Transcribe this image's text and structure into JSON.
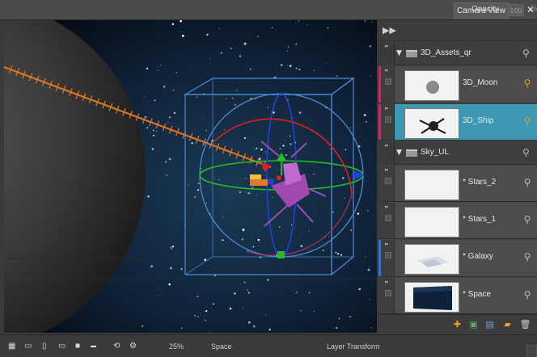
{
  "header": {
    "tab_label": "Camera View",
    "add_icon": "plus-icon",
    "close_icon": "close-icon"
  },
  "layers_panel": {
    "opacity_label": "Opacity",
    "opacity_value": "100",
    "opacity_suffix": "%",
    "groups": [
      {
        "name": "3D_Assets_qr",
        "layers": [
          {
            "name": "3D_Moon",
            "thumb": "moon",
            "strip_color": "#b8336a",
            "selected": false,
            "pin_icon": "gold-pin-icon"
          },
          {
            "name": "3D_Ship",
            "thumb": "ship",
            "strip_color": "#b8336a",
            "selected": true,
            "pin_icon": "gold-pin-icon"
          }
        ]
      },
      {
        "name": "Sky_UL",
        "layers": [
          {
            "name": "* Stars_2",
            "thumb": "blank",
            "strip_color": "",
            "selected": false,
            "pin_icon": "pin-icon"
          },
          {
            "name": "* Stars_1",
            "thumb": "blank",
            "strip_color": "",
            "selected": false,
            "pin_icon": "pin-icon"
          },
          {
            "name": "* Galaxy",
            "thumb": "galaxy",
            "strip_color": "#3a74c4",
            "selected": false,
            "pin_icon": "pin-icon"
          },
          {
            "name": "* Space",
            "thumb": "space",
            "strip_color": "",
            "selected": false,
            "pin_icon": "pin-icon"
          }
        ]
      }
    ],
    "footer_icons": [
      "add-layer-icon",
      "add-drawing-layer-icon",
      "add-color-card-icon",
      "add-group-icon",
      "delete-icon"
    ]
  },
  "status_bar": {
    "zoom": "25%",
    "space": "Space",
    "tool": "Layer Transform",
    "icons": [
      "grid-icon",
      "safe-area-icon",
      "frame-icon",
      "frame-wide-icon",
      "frame-black-icon",
      "timecode-icon",
      "onion-icon",
      "peg-icon"
    ]
  },
  "colors": {
    "accent_selected": "#3d98b4",
    "axis_red": "#e02020",
    "axis_green": "#20c020",
    "axis_blue": "#2040e0",
    "path_orange": "#e07a24",
    "bbox_blue": "#4f8ad6"
  }
}
